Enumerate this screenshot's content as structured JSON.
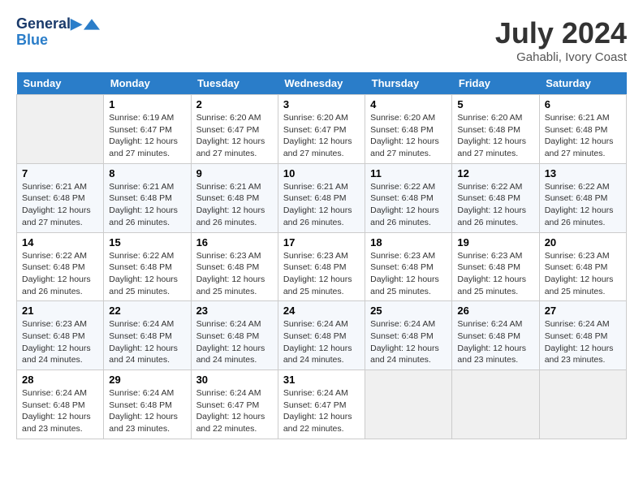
{
  "header": {
    "logo_line1": "General",
    "logo_line2": "Blue",
    "month_year": "July 2024",
    "location": "Gahabli, Ivory Coast"
  },
  "weekdays": [
    "Sunday",
    "Monday",
    "Tuesday",
    "Wednesday",
    "Thursday",
    "Friday",
    "Saturday"
  ],
  "weeks": [
    [
      {
        "day": "",
        "empty": true
      },
      {
        "day": "1",
        "sunrise": "6:19 AM",
        "sunset": "6:47 PM",
        "daylight": "12 hours and 27 minutes."
      },
      {
        "day": "2",
        "sunrise": "6:20 AM",
        "sunset": "6:47 PM",
        "daylight": "12 hours and 27 minutes."
      },
      {
        "day": "3",
        "sunrise": "6:20 AM",
        "sunset": "6:47 PM",
        "daylight": "12 hours and 27 minutes."
      },
      {
        "day": "4",
        "sunrise": "6:20 AM",
        "sunset": "6:48 PM",
        "daylight": "12 hours and 27 minutes."
      },
      {
        "day": "5",
        "sunrise": "6:20 AM",
        "sunset": "6:48 PM",
        "daylight": "12 hours and 27 minutes."
      },
      {
        "day": "6",
        "sunrise": "6:21 AM",
        "sunset": "6:48 PM",
        "daylight": "12 hours and 27 minutes."
      }
    ],
    [
      {
        "day": "7",
        "sunrise": "6:21 AM",
        "sunset": "6:48 PM",
        "daylight": "12 hours and 27 minutes."
      },
      {
        "day": "8",
        "sunrise": "6:21 AM",
        "sunset": "6:48 PM",
        "daylight": "12 hours and 26 minutes."
      },
      {
        "day": "9",
        "sunrise": "6:21 AM",
        "sunset": "6:48 PM",
        "daylight": "12 hours and 26 minutes."
      },
      {
        "day": "10",
        "sunrise": "6:21 AM",
        "sunset": "6:48 PM",
        "daylight": "12 hours and 26 minutes."
      },
      {
        "day": "11",
        "sunrise": "6:22 AM",
        "sunset": "6:48 PM",
        "daylight": "12 hours and 26 minutes."
      },
      {
        "day": "12",
        "sunrise": "6:22 AM",
        "sunset": "6:48 PM",
        "daylight": "12 hours and 26 minutes."
      },
      {
        "day": "13",
        "sunrise": "6:22 AM",
        "sunset": "6:48 PM",
        "daylight": "12 hours and 26 minutes."
      }
    ],
    [
      {
        "day": "14",
        "sunrise": "6:22 AM",
        "sunset": "6:48 PM",
        "daylight": "12 hours and 26 minutes."
      },
      {
        "day": "15",
        "sunrise": "6:22 AM",
        "sunset": "6:48 PM",
        "daylight": "12 hours and 25 minutes."
      },
      {
        "day": "16",
        "sunrise": "6:23 AM",
        "sunset": "6:48 PM",
        "daylight": "12 hours and 25 minutes."
      },
      {
        "day": "17",
        "sunrise": "6:23 AM",
        "sunset": "6:48 PM",
        "daylight": "12 hours and 25 minutes."
      },
      {
        "day": "18",
        "sunrise": "6:23 AM",
        "sunset": "6:48 PM",
        "daylight": "12 hours and 25 minutes."
      },
      {
        "day": "19",
        "sunrise": "6:23 AM",
        "sunset": "6:48 PM",
        "daylight": "12 hours and 25 minutes."
      },
      {
        "day": "20",
        "sunrise": "6:23 AM",
        "sunset": "6:48 PM",
        "daylight": "12 hours and 25 minutes."
      }
    ],
    [
      {
        "day": "21",
        "sunrise": "6:23 AM",
        "sunset": "6:48 PM",
        "daylight": "12 hours and 24 minutes."
      },
      {
        "day": "22",
        "sunrise": "6:24 AM",
        "sunset": "6:48 PM",
        "daylight": "12 hours and 24 minutes."
      },
      {
        "day": "23",
        "sunrise": "6:24 AM",
        "sunset": "6:48 PM",
        "daylight": "12 hours and 24 minutes."
      },
      {
        "day": "24",
        "sunrise": "6:24 AM",
        "sunset": "6:48 PM",
        "daylight": "12 hours and 24 minutes."
      },
      {
        "day": "25",
        "sunrise": "6:24 AM",
        "sunset": "6:48 PM",
        "daylight": "12 hours and 24 minutes."
      },
      {
        "day": "26",
        "sunrise": "6:24 AM",
        "sunset": "6:48 PM",
        "daylight": "12 hours and 23 minutes."
      },
      {
        "day": "27",
        "sunrise": "6:24 AM",
        "sunset": "6:48 PM",
        "daylight": "12 hours and 23 minutes."
      }
    ],
    [
      {
        "day": "28",
        "sunrise": "6:24 AM",
        "sunset": "6:48 PM",
        "daylight": "12 hours and 23 minutes."
      },
      {
        "day": "29",
        "sunrise": "6:24 AM",
        "sunset": "6:48 PM",
        "daylight": "12 hours and 23 minutes."
      },
      {
        "day": "30",
        "sunrise": "6:24 AM",
        "sunset": "6:47 PM",
        "daylight": "12 hours and 22 minutes."
      },
      {
        "day": "31",
        "sunrise": "6:24 AM",
        "sunset": "6:47 PM",
        "daylight": "12 hours and 22 minutes."
      },
      {
        "day": "",
        "empty": true
      },
      {
        "day": "",
        "empty": true
      },
      {
        "day": "",
        "empty": true
      }
    ]
  ]
}
